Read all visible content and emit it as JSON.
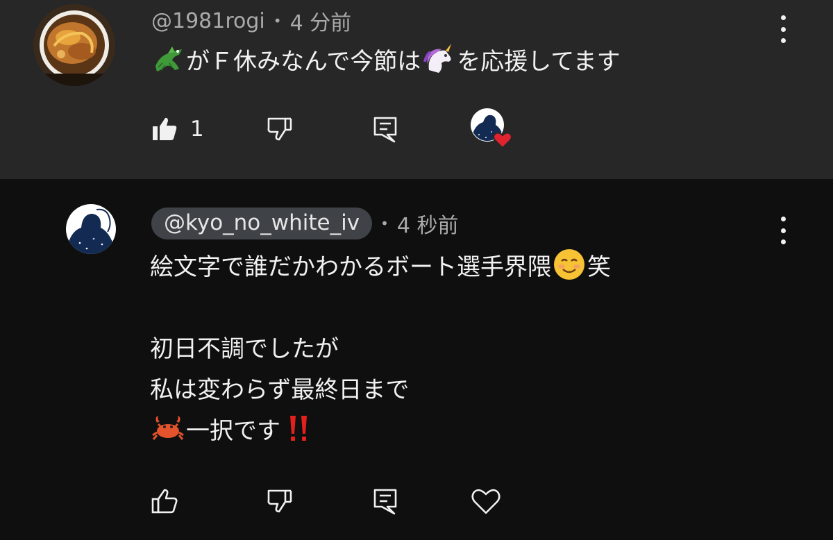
{
  "comments": [
    {
      "handle": "@1981rogi",
      "time": "4 分前",
      "text_part1": "がＦ休みなんで今節は",
      "text_part2": "を応援してます",
      "emoji1": "crocodile",
      "emoji2": "unicorn",
      "like_count": "1",
      "liked": true,
      "creator_hearted": true
    },
    {
      "handle": "@kyo_no_white_iv",
      "time": "4 秒前",
      "line1_a": "絵文字で誰だかわかるボート選手界隈",
      "line1_b": "笑",
      "line2": "初日不調でしたが",
      "line3": "私は変わらず最終日まで",
      "line4": "一択です",
      "emoji_smile": "smiling-face",
      "emoji_crab": "crab",
      "emoji_exclaim": "double-exclamation",
      "liked": false
    }
  ],
  "colors": {
    "panel": "#272727",
    "bg": "#0f0f0f",
    "text": "#f1f1f1",
    "meta": "#aaaaaa",
    "chip": "#3f4348",
    "heart": "#e0242f"
  }
}
